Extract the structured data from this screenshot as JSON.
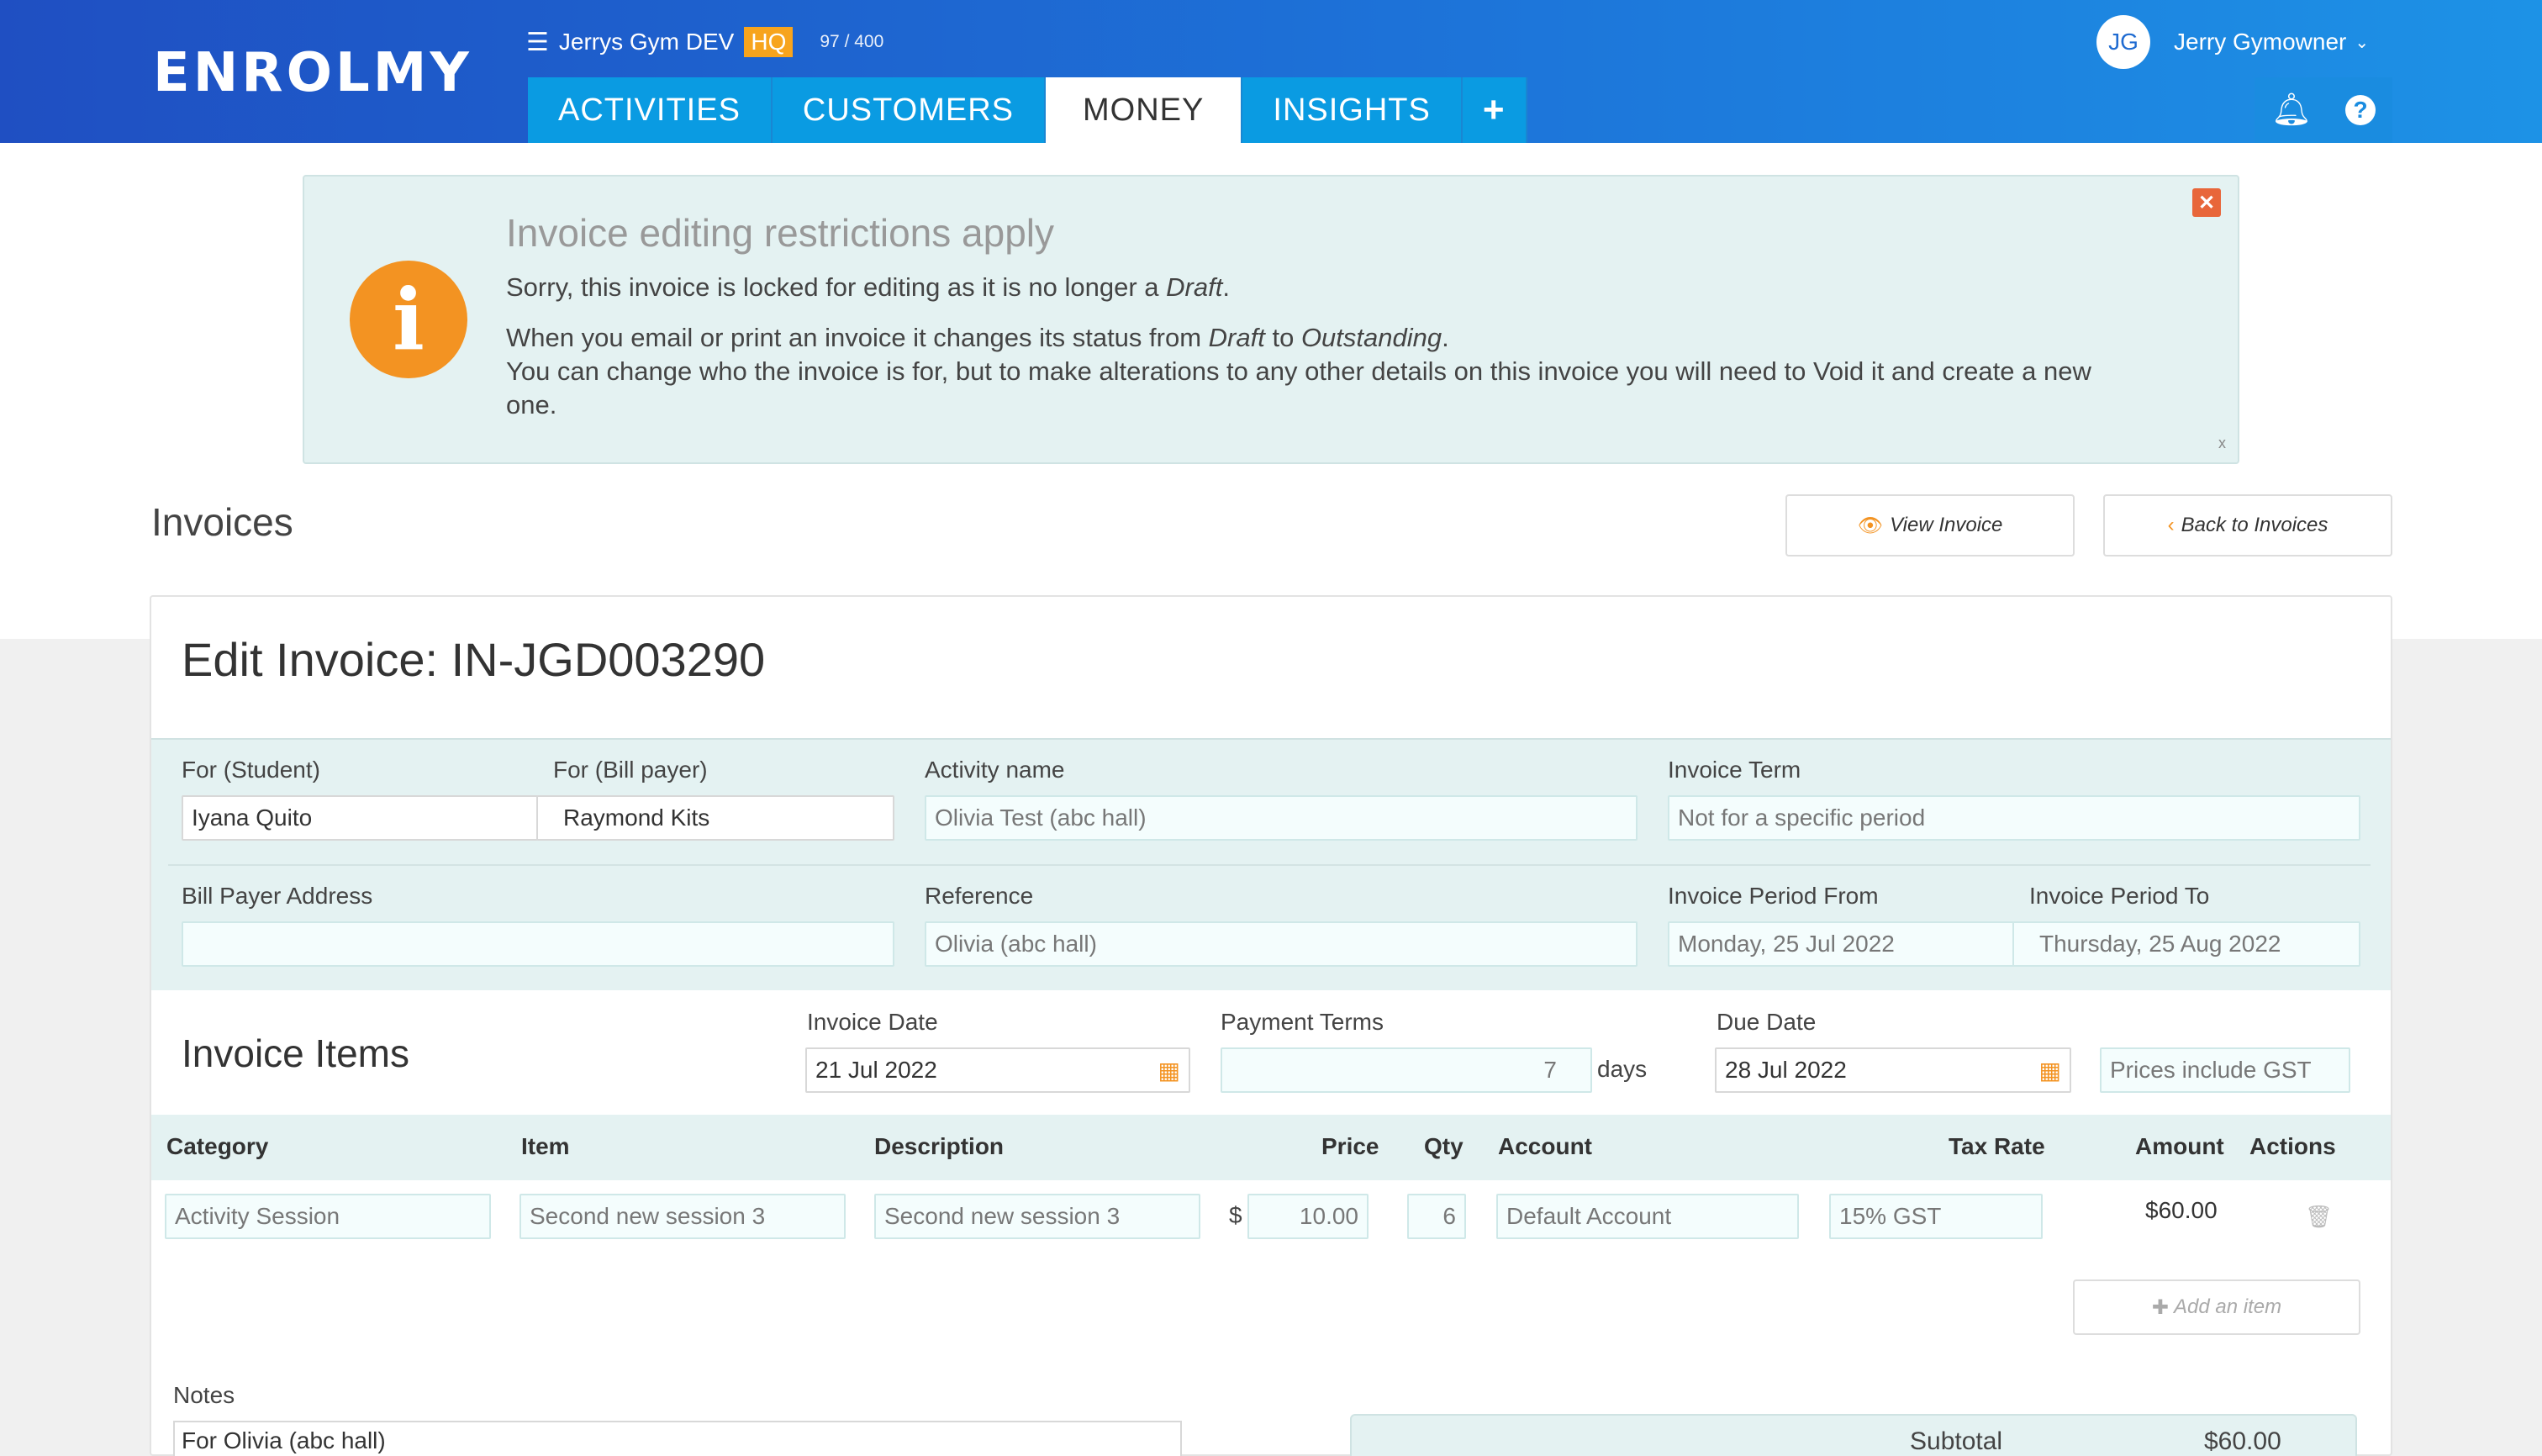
{
  "header": {
    "logo": "ENROLMY",
    "gym_name": "Jerrys Gym DEV",
    "hq_badge": "HQ",
    "count": "97 / 400",
    "user_initials": "JG",
    "user_name": "Jerry Gymowner",
    "tabs": [
      {
        "label": "ACTIVITIES"
      },
      {
        "label": "CUSTOMERS"
      },
      {
        "label": "MONEY"
      },
      {
        "label": "INSIGHTS"
      },
      {
        "label": "+"
      }
    ]
  },
  "alert": {
    "title": "Invoice editing restrictions apply",
    "line1_pre": "Sorry, this invoice is locked for editing as it is no longer a ",
    "line1_em": "Draft",
    "line1_post": ".",
    "line2_pre": "When you email or print an invoice it changes its status from ",
    "line2_em1": "Draft",
    "line2_mid": " to ",
    "line2_em2": "Outstanding",
    "line2_post": ".",
    "line3": "You can change who the invoice is for, but to make alterations to any other details on this invoice you will need to Void it and create a new one.",
    "close_small": "x"
  },
  "page": {
    "title": "Invoices",
    "view_invoice": "View Invoice",
    "back_to_invoices": "Back to Invoices",
    "edit_title": "Edit Invoice: IN-JGD003290"
  },
  "form": {
    "student_label": "For (Student)",
    "student_value": "Iyana Quito",
    "billpayer_label": "For (Bill payer)",
    "billpayer_value": "Raymond Kits",
    "activity_label": "Activity name",
    "activity_value": "Olivia Test (abc hall)",
    "term_label": "Invoice Term",
    "term_value": "Not for a specific period",
    "address_label": "Bill Payer Address",
    "address_value": "",
    "reference_label": "Reference",
    "reference_value": "Olivia (abc hall)",
    "period_from_label": "Invoice Period From",
    "period_from_value": "Monday, 25 Jul 2022",
    "period_to_label": "Invoice Period To",
    "period_to_value": "Thursday, 25 Aug 2022"
  },
  "items": {
    "title": "Invoice Items",
    "invoice_date_label": "Invoice Date",
    "invoice_date_value": "21 Jul 2022",
    "payment_terms_label": "Payment Terms",
    "payment_terms_value": "7",
    "days": "days",
    "due_date_label": "Due Date",
    "due_date_value": "28 Jul 2022",
    "gst_label": "Prices include GST",
    "columns": [
      "Category",
      "Item",
      "Description",
      "Price",
      "Qty",
      "Account",
      "Tax Rate",
      "Amount",
      "Actions"
    ],
    "row": {
      "category": "Activity Session",
      "item": "Second new session 3",
      "description": "Second new session 3",
      "currency": "$",
      "price": "10.00",
      "qty": "6",
      "account": "Default Account",
      "tax_rate": "15% GST",
      "amount": "$60.00"
    },
    "add_item": "Add an item"
  },
  "notes": {
    "label": "Notes",
    "value": "For Olivia (abc hall)"
  },
  "totals": {
    "subtotal_label": "Subtotal",
    "subtotal_value": "$60.00"
  }
}
